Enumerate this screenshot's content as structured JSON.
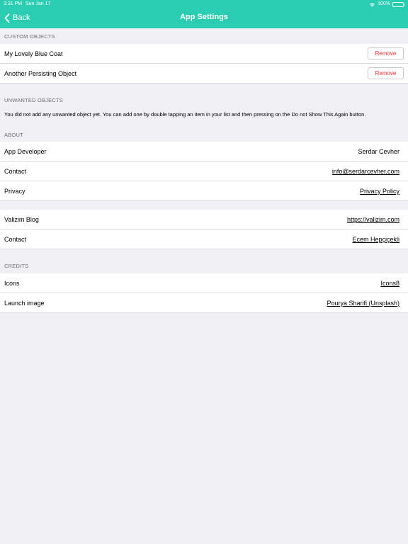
{
  "status_bar": {
    "time": "3:31 PM",
    "date": "Sun Jan 17",
    "battery": "100%"
  },
  "nav": {
    "back_label": "Back",
    "title": "App Settings"
  },
  "custom_objects": {
    "header": "CUSTOM OBJECTS",
    "items": [
      {
        "label": "My Lovely Blue Coat",
        "button": "Remove"
      },
      {
        "label": "Another Persisting Object",
        "button": "Remove"
      }
    ]
  },
  "unwanted_objects": {
    "header": "UNWANTED OBJECTS",
    "message": "You did not add any unwanted object yet. You can add one by double tapping an item in your list and then pressing on the Do not Show This Again button."
  },
  "about": {
    "header": "ABOUT",
    "rows": [
      {
        "label": "App Developer",
        "value": "Serdar Cevher"
      },
      {
        "label": "Contact",
        "value": "info@serdarcevher.com"
      },
      {
        "label": "Privacy",
        "value": "Privacy Policy"
      }
    ]
  },
  "blog": {
    "rows": [
      {
        "label": "Valizim Blog",
        "value": "https://valizim.com"
      },
      {
        "label": "Contact",
        "value": "Ecem Hepçiçekli"
      }
    ]
  },
  "credits": {
    "header": "CREDITS",
    "rows": [
      {
        "label": "Icons",
        "value": "Icons8"
      },
      {
        "label": "Launch image",
        "value": "Pourya Sharifi (Unsplash)"
      }
    ]
  },
  "colors": {
    "accent": "#2bcdb2",
    "destructive": "#ff2d2d",
    "background": "#efeff4"
  }
}
